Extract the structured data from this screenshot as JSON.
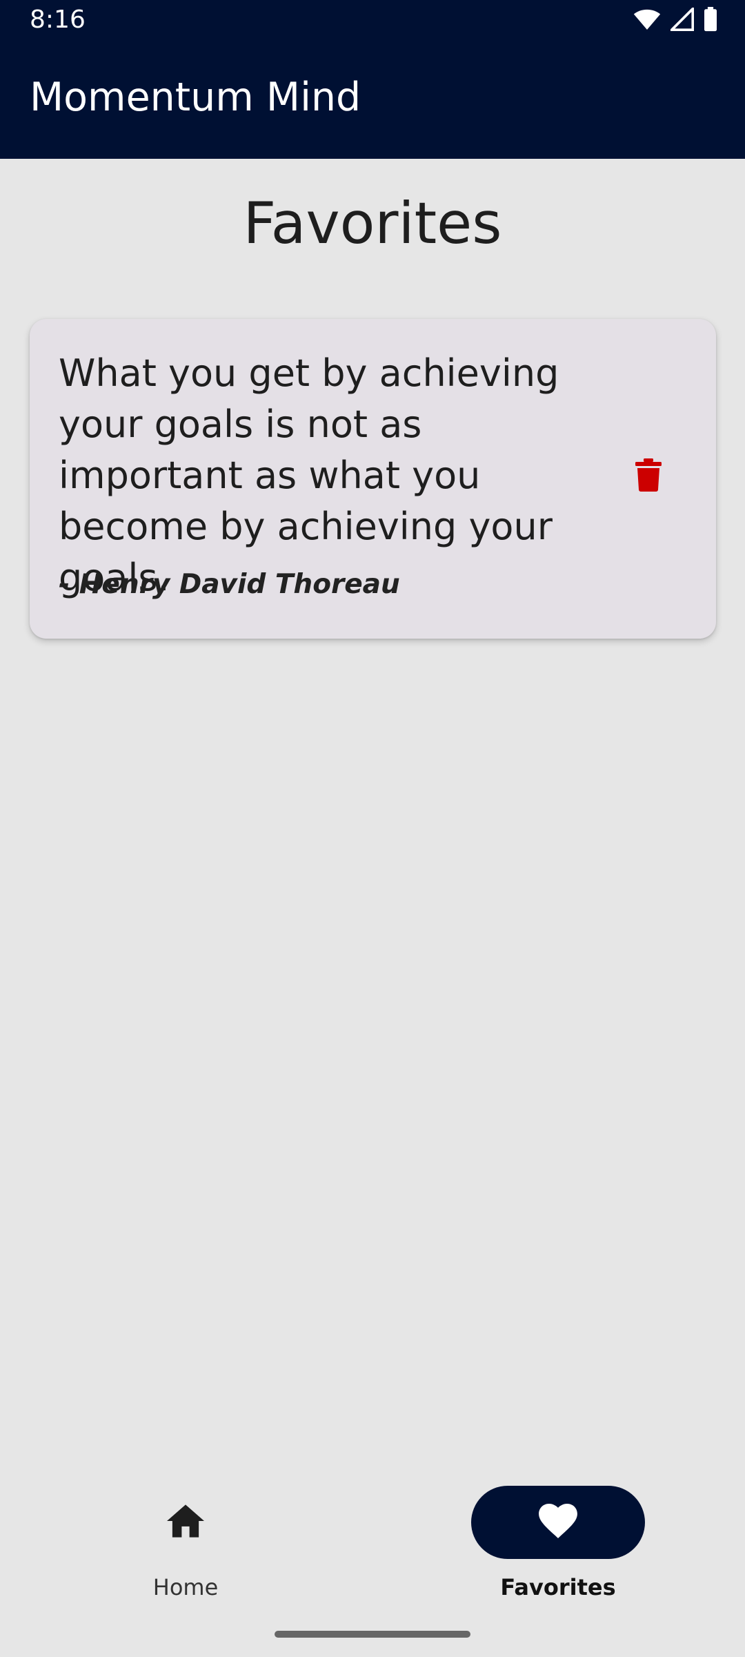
{
  "status_bar": {
    "time": "8:16",
    "icons": [
      "wifi-icon",
      "signal-icon",
      "battery-icon"
    ]
  },
  "app_bar": {
    "title": "Momentum Mind"
  },
  "page": {
    "title": "Favorites"
  },
  "favorites": [
    {
      "quote": "What you get by achieving your goals is not as important as what you become by achieving your goals.",
      "author": "- Henry David Thoreau",
      "delete_icon": "trash-icon"
    }
  ],
  "bottom_nav": {
    "items": [
      {
        "label": "Home",
        "icon": "home-icon",
        "selected": false
      },
      {
        "label": "Favorites",
        "icon": "heart-icon",
        "selected": true
      }
    ]
  },
  "colors": {
    "primary": "#001033",
    "background": "#e6e6e6",
    "card": "#e4e0e6",
    "delete": "#cc0000"
  }
}
